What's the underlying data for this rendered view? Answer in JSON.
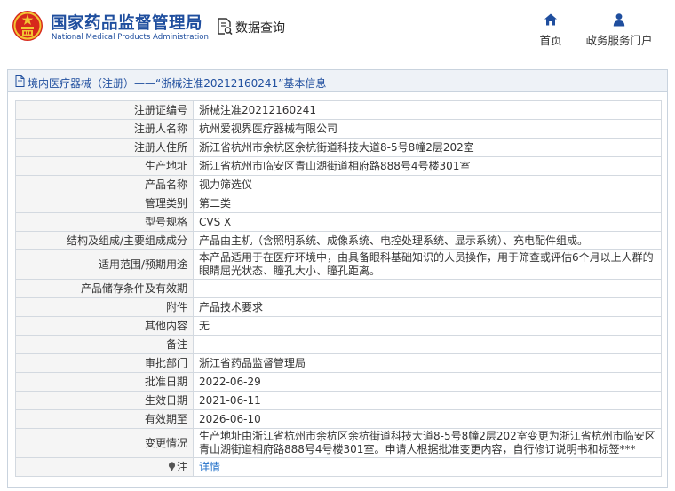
{
  "header": {
    "brand_cn": "国家药品监督管理局",
    "brand_en": "National Medical Products Administration",
    "query_label": "数据查询",
    "nav": {
      "home": "首页",
      "service": "政务服务门户"
    },
    "colors": {
      "brand": "#1f4e9e",
      "emblem_red": "#d7281c",
      "emblem_gold": "#f2c433"
    },
    "icons": {
      "emblem": "national-emblem",
      "query": "document-search-icon",
      "home": "home-icon",
      "service": "user-icon"
    }
  },
  "panel": {
    "title": "境内医疗器械（注册）——“浙械注准20212160241”基本信息",
    "title_icon": "document-icon"
  },
  "rows": [
    {
      "label": "注册证编号",
      "value": "浙械注准20212160241"
    },
    {
      "label": "注册人名称",
      "value": "杭州爱视界医疗器械有限公司"
    },
    {
      "label": "注册人住所",
      "value": "浙江省杭州市余杭区余杭街道科技大道8-5号8幢2层202室"
    },
    {
      "label": "生产地址",
      "value": "浙江省杭州市临安区青山湖街道相府路888号4号楼301室"
    },
    {
      "label": "产品名称",
      "value": "视力筛选仪"
    },
    {
      "label": "管理类别",
      "value": "第二类"
    },
    {
      "label": "型号规格",
      "value": "CVS X"
    },
    {
      "label": "结构及组成/主要组成成分",
      "value": "产品由主机（含照明系统、成像系统、电控处理系统、显示系统）、充电配件组成。"
    },
    {
      "label": "适用范围/预期用途",
      "value": "本产品适用于在医疗环境中，由具备眼科基础知识的人员操作，用于筛查或评估6个月以上人群的眼睛屈光状态、瞳孔大小、瞳孔距离。"
    },
    {
      "label": "产品储存条件及有效期",
      "value": ""
    },
    {
      "label": "附件",
      "value": "产品技术要求"
    },
    {
      "label": "其他内容",
      "value": "无"
    },
    {
      "label": "备注",
      "value": ""
    },
    {
      "label": "审批部门",
      "value": "浙江省药品监督管理局"
    },
    {
      "label": "批准日期",
      "value": "2022-06-29"
    },
    {
      "label": "生效日期",
      "value": "2021-06-11"
    },
    {
      "label": "有效期至",
      "value": "2026-06-10"
    },
    {
      "label": "变更情况",
      "value": "生产地址由浙江省杭州市余杭区余杭街道科技大道8-5号8幢2层202室变更为浙江省杭州市临安区青山湖街道相府路888号4号楼301室。申请人根据批准变更内容，自行修订说明书和标签***"
    },
    {
      "label": "注",
      "value": "详情",
      "label_icon": "pin-icon"
    }
  ]
}
